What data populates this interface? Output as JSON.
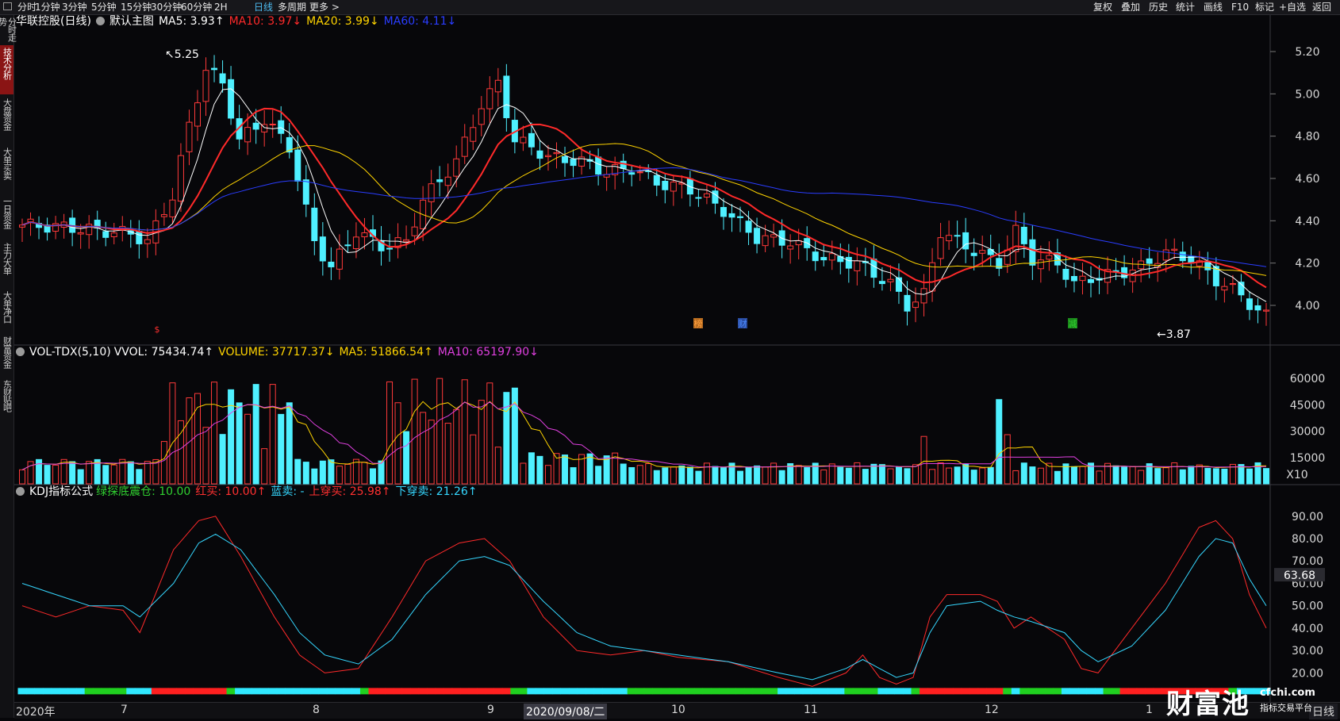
{
  "toolbar": {
    "left_items": [
      "分时",
      "1分钟",
      "3分钟",
      "5分钟",
      "15分钟",
      "30分钟",
      "60分钟",
      "2H",
      "日线",
      "多周期",
      "更多 >"
    ],
    "active_item": "日线",
    "right_items": [
      "复权",
      "叠加",
      "历史",
      "统计",
      "画线",
      "F10",
      "标记",
      "+自选",
      "返回"
    ]
  },
  "sidebar": {
    "items": [
      "分时走势",
      "技术分析",
      "大盘资金",
      "大单买卖",
      "一日资金",
      "主力大单",
      "大单净口",
      "财富资金",
      "东财贴吧"
    ],
    "active": "技术分析"
  },
  "main_legend": {
    "stock": "华联控股(日线)",
    "template": "默认主图",
    "ma5": "MA5: 3.93↑",
    "ma10": "MA10: 3.97↓",
    "ma20": "MA20: 3.99↓",
    "ma60": "MA60: 4.11↓",
    "colors": {
      "ma5": "#ffffff",
      "ma10": "#ff2a2a",
      "ma20": "#ffd400",
      "ma60": "#2a3dff"
    }
  },
  "vol_legend": {
    "name": "VOL-TDX(5,10)",
    "vvol": "VVOL: 75434.74↑",
    "volume": "VOLUME: 37717.37↓",
    "ma5": "MA5: 51866.54↑",
    "ma10": "MA10: 65197.90↓"
  },
  "kdj_legend": {
    "name": "KDJ指标公式",
    "lvtan": "绿探底震仓: 10.00",
    "hongmai": "红买: 10.00↑",
    "lanmai": "蓝卖: -",
    "shangchuan": "上穿买: 25.98↑",
    "xiachuan": "下穿卖: 21.26↑"
  },
  "price_axis": [
    "5.20",
    "5.00",
    "4.80",
    "4.60",
    "4.40",
    "4.20",
    "4.00"
  ],
  "vol_axis": [
    "60000",
    "45000",
    "30000",
    "15000"
  ],
  "vol_unit": "X10",
  "kdj_axis": [
    "90.00",
    "80.00",
    "70.00",
    "60.00",
    "50.00",
    "40.00",
    "30.00",
    "20.00"
  ],
  "kdj_current": "63.68",
  "annotations": {
    "high": "5.25",
    "low": "3.87"
  },
  "markers": [
    "$",
    "榜",
    "财",
    "减"
  ],
  "bottom": {
    "left_label": "2020年",
    "x_labels": [
      "7",
      "8",
      "9",
      "10",
      "11",
      "12",
      "1"
    ],
    "cursor_date": "2020/09/08/二",
    "period": "日线"
  },
  "logo": {
    "text": "财富池",
    "domain": "cfchi.com",
    "tagline": "指标交易平台"
  },
  "chart_data": {
    "type": "candlestick",
    "price_ylim": [
      3.8,
      5.3
    ],
    "candles_ohlc_pattern": "daily bars from 2020-06 to 2021-01, derived from MA path",
    "ma_series": [
      "MA5",
      "MA10",
      "MA20",
      "MA60"
    ],
    "kdj_series": [
      "K",
      "D"
    ],
    "kdj_ylim": [
      10,
      95
    ]
  }
}
